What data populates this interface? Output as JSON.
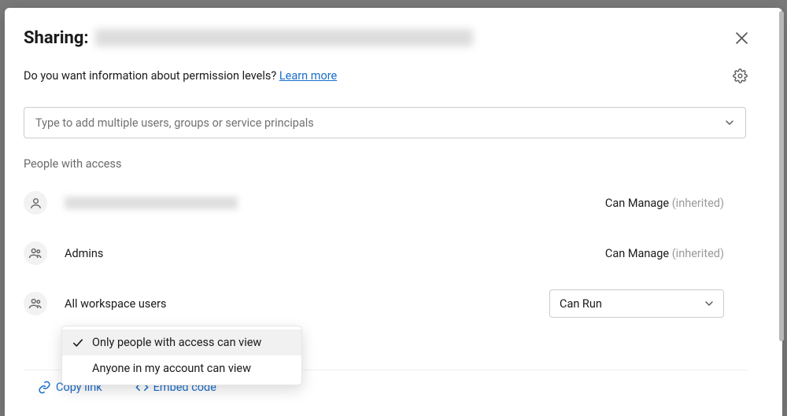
{
  "header": {
    "sharing_label": "Sharing:"
  },
  "info": {
    "question": "Do you want information about permission levels? ",
    "learn_more": "Learn more"
  },
  "search": {
    "placeholder": "Type to add multiple users, groups or service principals"
  },
  "section_label": "People with access",
  "principals": [
    {
      "name": "",
      "blurred": true,
      "permission": "Can Manage",
      "inherited": "(inherited)",
      "type": "user",
      "editable": false
    },
    {
      "name": "Admins",
      "blurred": false,
      "permission": "Can Manage",
      "inherited": "(inherited)",
      "type": "group",
      "editable": false
    },
    {
      "name": "All workspace users",
      "blurred": false,
      "permission": "Can Run",
      "inherited": "",
      "type": "group",
      "editable": true
    }
  ],
  "visibility_options": [
    {
      "label": "Only people with access can view",
      "selected": true
    },
    {
      "label": "Anyone in my account can view",
      "selected": false
    }
  ],
  "footer": {
    "copy_link": "Copy link",
    "embed_code": "Embed code"
  }
}
